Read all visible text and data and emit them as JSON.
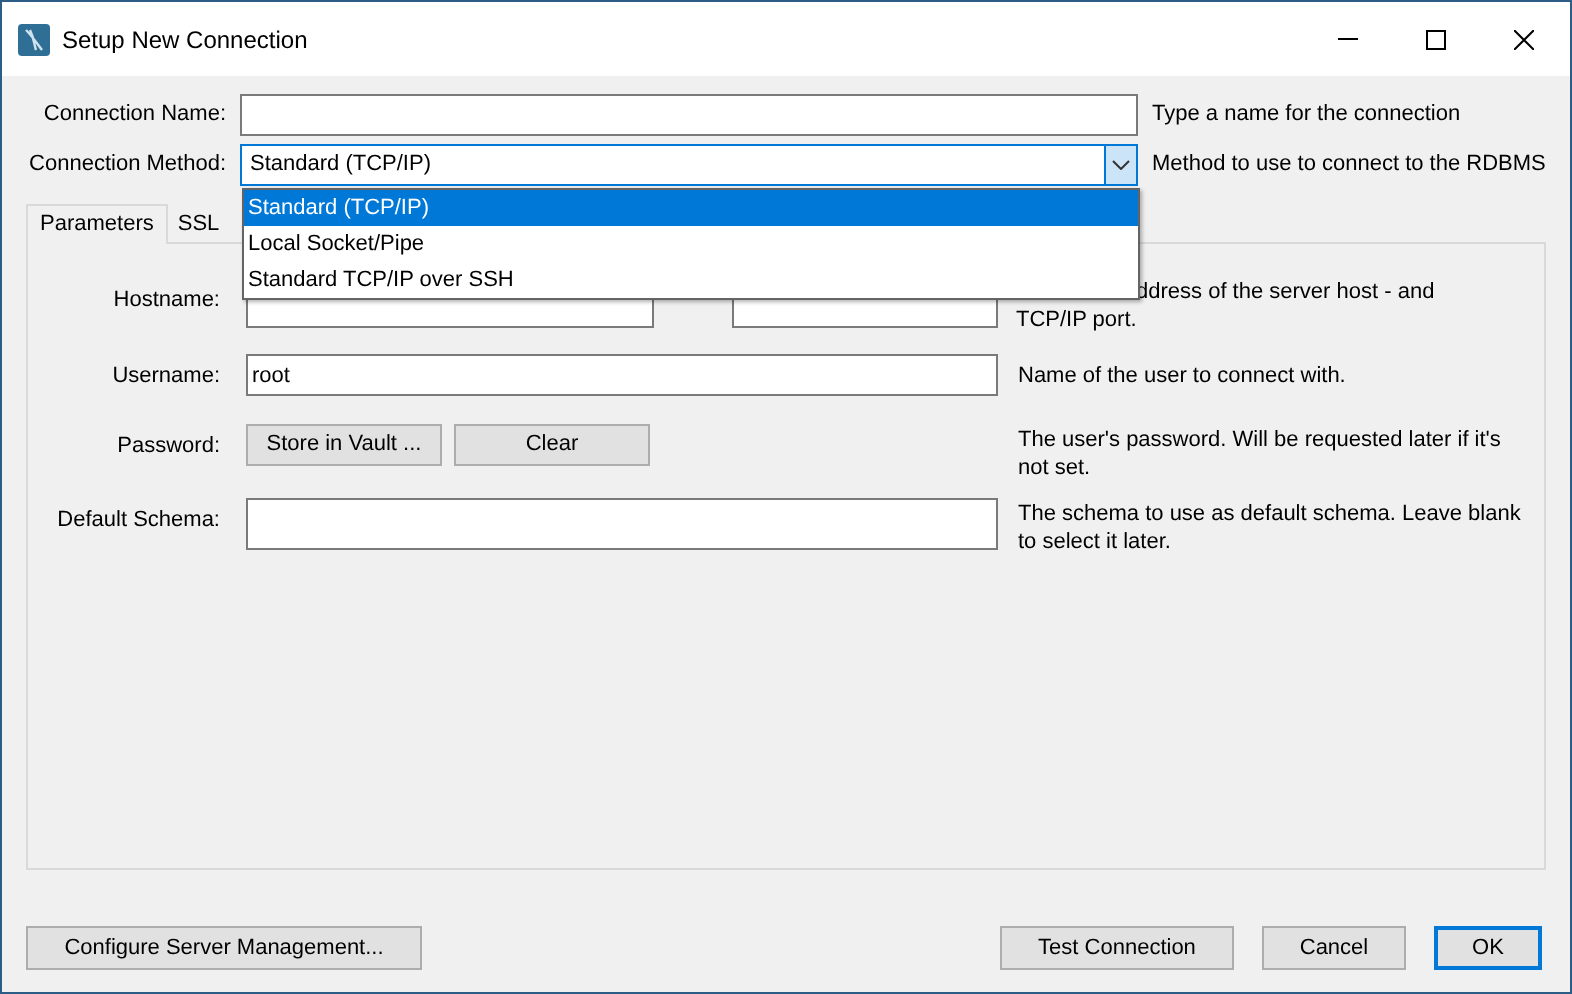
{
  "window": {
    "title": "Setup New Connection"
  },
  "connection_name": {
    "label": "Connection Name:",
    "hint": "Type a name for the connection"
  },
  "connection_method": {
    "label": "Connection Method:",
    "value": "Standard (TCP/IP)",
    "hint": "Method to use to connect to the RDBMS",
    "expanded": true,
    "options": [
      {
        "label": "Standard (TCP/IP)",
        "selected": true
      },
      {
        "label": "Local Socket/Pipe",
        "selected": false
      },
      {
        "label": "Standard TCP/IP over SSH",
        "selected": false
      }
    ]
  },
  "tabs": [
    {
      "label": "Parameters",
      "selected": true
    },
    {
      "label": "SSL",
      "selected": false
    }
  ],
  "hostname": {
    "label": "Hostname:",
    "hint_lines": [
      "ddress of the server host - and",
      "TCP/IP port."
    ]
  },
  "username": {
    "label": "Username:",
    "value": "root",
    "hint": "Name of the user to connect with."
  },
  "password": {
    "label": "Password:",
    "buttons": [
      "Store in Vault ...",
      "Clear"
    ],
    "hint": "The user's password. Will be requested later if it's not set."
  },
  "default_schema": {
    "label": "Default Schema:",
    "hint": "The schema to use as default schema. Leave blank to select it later."
  },
  "footer": {
    "left_button": "Configure Server Management...",
    "buttons": [
      {
        "label": "Test Connection",
        "kind": "normal"
      },
      {
        "label": "Cancel",
        "kind": "normal"
      },
      {
        "label": "OK",
        "kind": "default"
      }
    ]
  }
}
